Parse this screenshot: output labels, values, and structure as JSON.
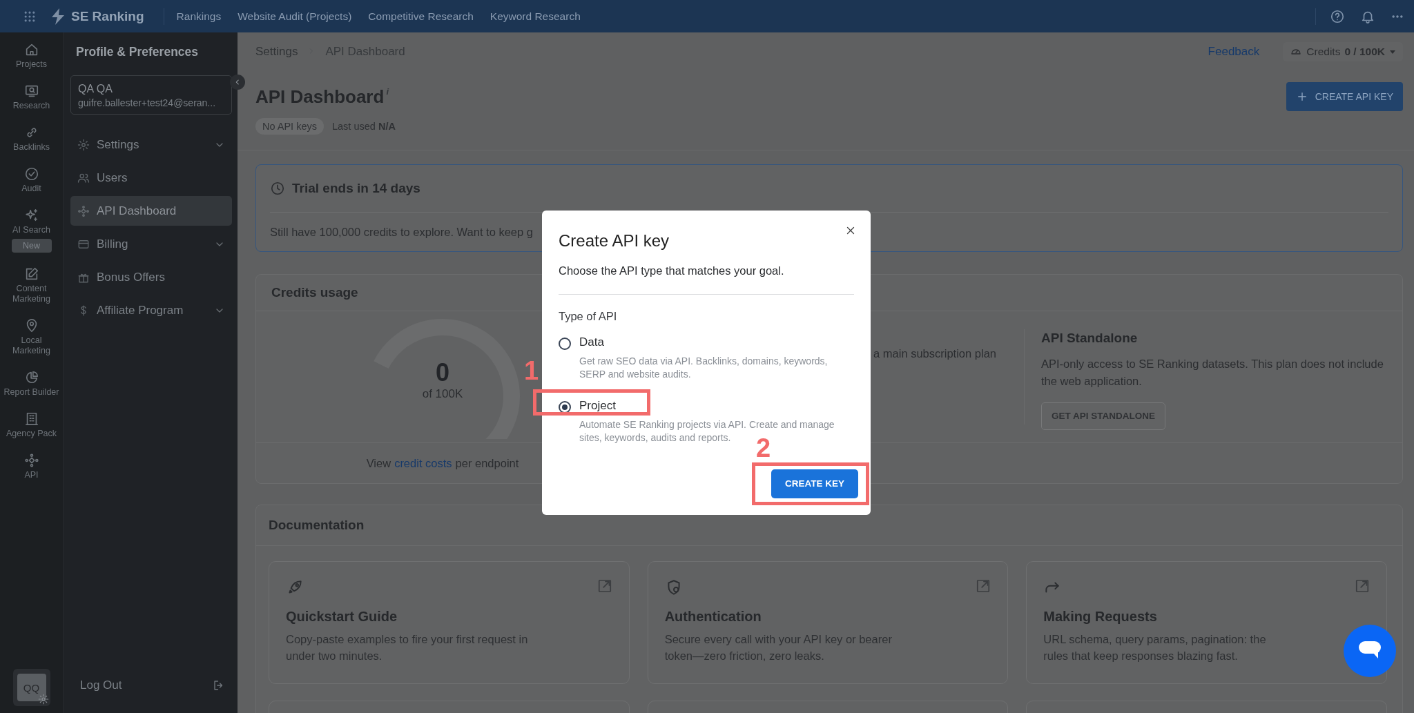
{
  "topbar": {
    "logo": "SE Ranking",
    "nav": [
      "Rankings",
      "Website Audit (Projects)",
      "Competitive Research",
      "Keyword Research"
    ]
  },
  "rail": {
    "items": [
      {
        "label": "Projects"
      },
      {
        "label": "Research"
      },
      {
        "label": "Backlinks"
      },
      {
        "label": "Audit"
      },
      {
        "label": "AI Search",
        "badge": "New"
      },
      {
        "label": "Content Marketing"
      },
      {
        "label": "Local Marketing"
      },
      {
        "label": "Report Builder"
      },
      {
        "label": "Agency Pack"
      },
      {
        "label": "API"
      }
    ],
    "avatar": "QQ"
  },
  "sidebar": {
    "title": "Profile & Preferences",
    "user": {
      "name": "QA QA",
      "email": "guifre.ballester+test24@seran..."
    },
    "items": [
      {
        "label": "Settings",
        "selected": false,
        "has_children": true
      },
      {
        "label": "Users",
        "selected": false,
        "has_children": false
      },
      {
        "label": "API Dashboard",
        "selected": true,
        "has_children": false
      },
      {
        "label": "Billing",
        "selected": false,
        "has_children": true
      },
      {
        "label": "Bonus Offers",
        "selected": false,
        "has_children": false
      },
      {
        "label": "Affiliate Program",
        "selected": false,
        "has_children": true
      }
    ],
    "logout": "Log Out"
  },
  "header": {
    "breadcrumb": [
      "Settings",
      "API Dashboard"
    ],
    "feedback": "Feedback",
    "credits_label": "Credits",
    "credits_value": "0 / 100K",
    "title": "API Dashboard",
    "title_mark": "i",
    "create_button": "CREATE API KEY",
    "keys_chip": "No API keys",
    "last_used_label": "Last used",
    "last_used_value": "N/A"
  },
  "trial": {
    "title": "Trial ends in 14 days",
    "text": "Still have 100,000 credits to explore. Want to keep g"
  },
  "credits_usage": {
    "title": "Credits usage",
    "gauge": {
      "value": "0",
      "caption": "of 100K"
    },
    "middle_fragment": "a main subscription plan",
    "footer": {
      "before": "View",
      "link": "credit costs",
      "after": "per endpoint"
    },
    "standalone": {
      "title": "API Standalone",
      "text": "API-only access to SE Ranking datasets. This plan does not include the web application.",
      "button": "GET API STANDALONE"
    }
  },
  "documentation": {
    "title": "Documentation",
    "cards": [
      {
        "title": "Quickstart Guide",
        "text": "Copy-paste examples to fire your first request in under two minutes."
      },
      {
        "title": "Authentication",
        "text": "Secure every call with your API key or bearer token—zero friction, zero leaks."
      },
      {
        "title": "Making Requests",
        "text": "URL schema, query params, pagination: the rules that keep responses blazing fast."
      }
    ]
  },
  "modal": {
    "title": "Create API key",
    "subtitle": "Choose the API type that matches your goal.",
    "group_label": "Type of API",
    "options": [
      {
        "label": "Data",
        "description": "Get raw SEO data via API. Backlinks, domains, keywords, SERP and website audits.",
        "selected": false
      },
      {
        "label": "Project",
        "description": "Automate SE Ranking projects via API. Create and manage sites, keywords, audits and reports.",
        "selected": true,
        "annotation": "1"
      }
    ],
    "button": "CREATE KEY",
    "button_annotation": "2"
  }
}
